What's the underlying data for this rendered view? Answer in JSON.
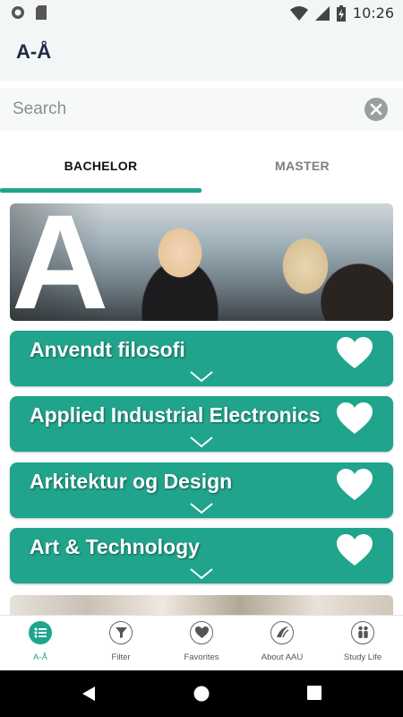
{
  "status_bar": {
    "time": "10:26"
  },
  "app_bar": {
    "title": "A-Å"
  },
  "search": {
    "placeholder": "Search",
    "value": ""
  },
  "tabs": [
    {
      "label": "BACHELOR",
      "active": true
    },
    {
      "label": "MASTER",
      "active": false
    }
  ],
  "banner": {
    "letter": "A"
  },
  "programs": [
    {
      "title": "Anvendt filosofi"
    },
    {
      "title": "Applied Industrial Electronics"
    },
    {
      "title": "Arkitektur og Design"
    },
    {
      "title": "Art & Technology"
    }
  ],
  "bottom_nav": [
    {
      "label": "A-Å",
      "icon": "list-icon",
      "active": true
    },
    {
      "label": "Filter",
      "icon": "filter-icon",
      "active": false
    },
    {
      "label": "Favorites",
      "icon": "heart-icon",
      "active": false
    },
    {
      "label": "About AAU",
      "icon": "aau-logo-icon",
      "active": false
    },
    {
      "label": "Study Life",
      "icon": "people-icon",
      "active": false
    }
  ],
  "colors": {
    "accent": "#1fa58b",
    "card": "#20a48c",
    "title": "#1f2a44"
  }
}
